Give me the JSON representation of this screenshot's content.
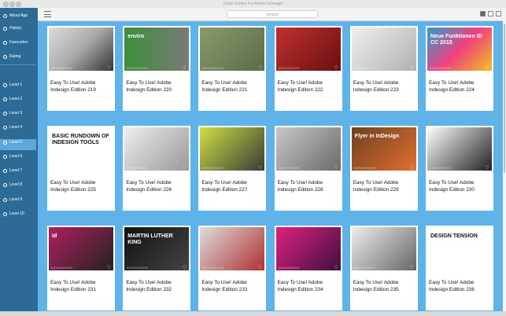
{
  "window": {
    "title": "Deep Guides For Adobe InDesign"
  },
  "toolbar": {
    "search_placeholder": "Search"
  },
  "sidebar": {
    "items": [
      {
        "label": "About App",
        "icon": "info-icon"
      },
      {
        "label": "History",
        "icon": "clock-icon"
      },
      {
        "label": "Favourites",
        "icon": "heart-icon"
      },
      {
        "label": "Rating",
        "icon": "star-icon"
      },
      {
        "label": "Level 1",
        "icon": "level-icon"
      },
      {
        "label": "Level 2",
        "icon": "level-icon"
      },
      {
        "label": "Level 3",
        "icon": "level-icon"
      },
      {
        "label": "Level 4",
        "icon": "level-icon"
      },
      {
        "label": "Level 5",
        "icon": "level-icon"
      },
      {
        "label": "Level 6",
        "icon": "level-icon"
      },
      {
        "label": "Level 7",
        "icon": "level-icon"
      },
      {
        "label": "Level 8",
        "icon": "level-icon"
      },
      {
        "label": "Level 9",
        "icon": "level-icon"
      },
      {
        "label": "Level 10",
        "icon": "level-icon"
      }
    ],
    "active": "Level 5"
  },
  "cards": [
    {
      "title": "Easy To Use! Adobe Indesign Edition 219",
      "thumb_text": ""
    },
    {
      "title": "Easy To Use! Adobe Indesign Edition 220",
      "thumb_text": "enviro"
    },
    {
      "title": "Easy To Use! Adobe Indesign Edition 221",
      "thumb_text": ""
    },
    {
      "title": "Easy To Use! Adobe Indesign Edition 222",
      "thumb_text": ""
    },
    {
      "title": "Easy To Use! Adobe Indesign Edition 223",
      "thumb_text": ""
    },
    {
      "title": "Easy To Use! Adobe Indesign Edition 224",
      "thumb_text": "Neue Funktionen ID CC 2015"
    },
    {
      "title": "Easy To Use! Adobe Indesign Edition 225",
      "thumb_text": "BASIC RUNDOWN OF INDESIGN TOOLS"
    },
    {
      "title": "Easy To Use! Adobe Indesign Edition 226",
      "thumb_text": ""
    },
    {
      "title": "Easy To Use! Adobe Indesign Edition 227",
      "thumb_text": ""
    },
    {
      "title": "Easy To Use! Adobe Indesign Edition 228",
      "thumb_text": ""
    },
    {
      "title": "Easy To Use! Adobe Indesign Edition 229",
      "thumb_text": "Flyer in InDesign"
    },
    {
      "title": "Easy To Use! Adobe Indesign Edition 230",
      "thumb_text": ""
    },
    {
      "title": "Easy To Use! Adobe Indesign Edition 231",
      "thumb_text": "Id"
    },
    {
      "title": "Easy To Use! Adobe Indesign Edition 232",
      "thumb_text": "MARTIN LUTHER KING"
    },
    {
      "title": "Easy To Use! Adobe Indesign Edition 233",
      "thumb_text": ""
    },
    {
      "title": "Easy To Use! Adobe Indesign Edition 234",
      "thumb_text": ""
    },
    {
      "title": "Easy To Use! Adobe Indesign Edition 235",
      "thumb_text": ""
    },
    {
      "title": "Easy To Use! Adobe Indesign Edition 236",
      "thumb_text": "DESIGN TENSION"
    }
  ],
  "colors": {
    "background": "#5fb3e8",
    "sidebar": "#2d6b96",
    "sidebar_active": "#5ea8dd"
  }
}
